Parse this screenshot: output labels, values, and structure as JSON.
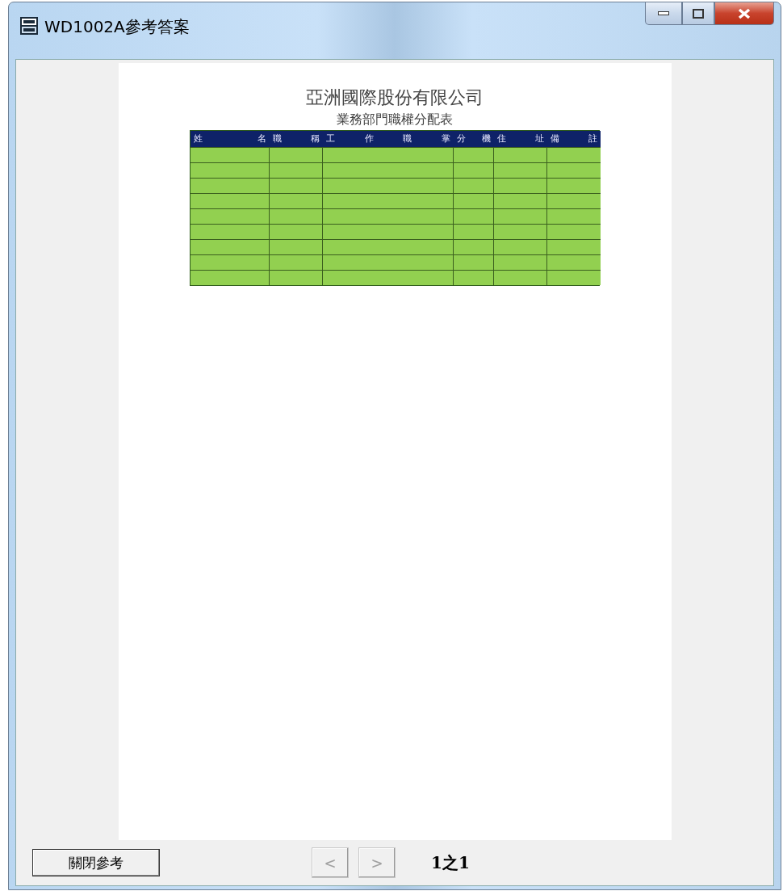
{
  "window": {
    "title": "WD1002A參考答案"
  },
  "document": {
    "company": "亞洲國際股份有限公司",
    "subtitle": "業務部門職權分配表",
    "table": {
      "columns": [
        "姓 名",
        "職 稱",
        "工 作 職 掌",
        "分 機",
        "住 址",
        "備 註"
      ],
      "rows": [
        {
          "kind": "blank"
        },
        {
          "kind": "blank"
        },
        {
          "kind": "blank"
        },
        {
          "kind": "blank"
        },
        {
          "kind": "blank"
        },
        {
          "kind": "blank"
        },
        {
          "kind": "blank"
        },
        {
          "kind": "blank"
        },
        {
          "kind": "blank"
        }
      ]
    }
  },
  "footer": {
    "close_button": "關閉參考",
    "prev": {
      "label": "<",
      "disabled": true
    },
    "next": {
      "label": ">",
      "disabled": true
    },
    "page": "1之1"
  }
}
